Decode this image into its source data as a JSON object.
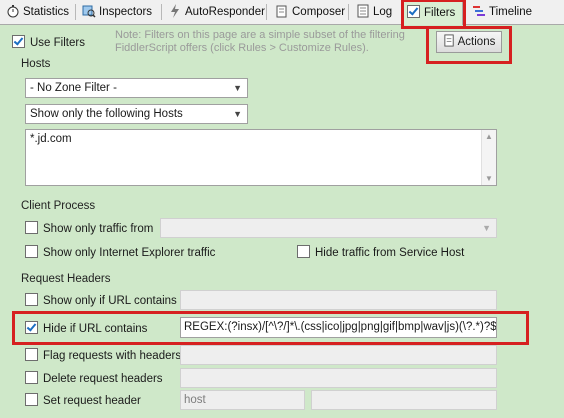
{
  "tabs": [
    {
      "label": "Statistics",
      "icon": "stopwatch-icon"
    },
    {
      "label": "Inspectors",
      "icon": "magnifier-icon"
    },
    {
      "label": "AutoResponder",
      "icon": "lightning-icon"
    },
    {
      "label": "Composer",
      "icon": "pencil-icon"
    },
    {
      "label": "Log",
      "icon": "log-icon"
    },
    {
      "label": "Filters",
      "icon": "checkbox-icon",
      "active": true
    },
    {
      "label": "Timeline",
      "icon": "timeline-icon"
    }
  ],
  "use_filters": {
    "label": "Use Filters",
    "checked": true
  },
  "note": "Note: Filters on this page are a simple subset of the filtering FiddlerScript offers (click Rules > Customize Rules).",
  "actions_button": "Actions",
  "hosts": {
    "title": "Hosts",
    "zone_filter": "- No Zone Filter -",
    "host_filter": "Show only the following Hosts",
    "host_list": "*.jd.com"
  },
  "client_process": {
    "title": "Client Process",
    "show_only_traffic_from": {
      "label": "Show only traffic from",
      "checked": false,
      "value": ""
    },
    "show_only_ie": {
      "label": "Show only Internet Explorer traffic",
      "checked": false
    },
    "hide_service_host": {
      "label": "Hide traffic from Service Host",
      "checked": false
    }
  },
  "request_headers": {
    "title": "Request Headers",
    "show_if_url": {
      "label": "Show only if URL contains",
      "checked": false,
      "value": ""
    },
    "hide_if_url": {
      "label": "Hide if URL contains",
      "checked": true,
      "value": "REGEX:(?insx)/[^\\?/]*\\.(css|ico|jpg|png|gif|bmp|wav|js)(\\?.*)?$"
    },
    "flag_with_headers": {
      "label": "Flag requests with headers",
      "checked": false,
      "value": ""
    },
    "delete_headers": {
      "label": "Delete request headers",
      "checked": false,
      "value": ""
    },
    "set_header": {
      "label": "Set request header",
      "checked": false,
      "name_placeholder": "host",
      "value": ""
    }
  },
  "colors": {
    "background": "#cfe8c9",
    "highlight": "#d62020",
    "check": "#1b6ec2"
  }
}
